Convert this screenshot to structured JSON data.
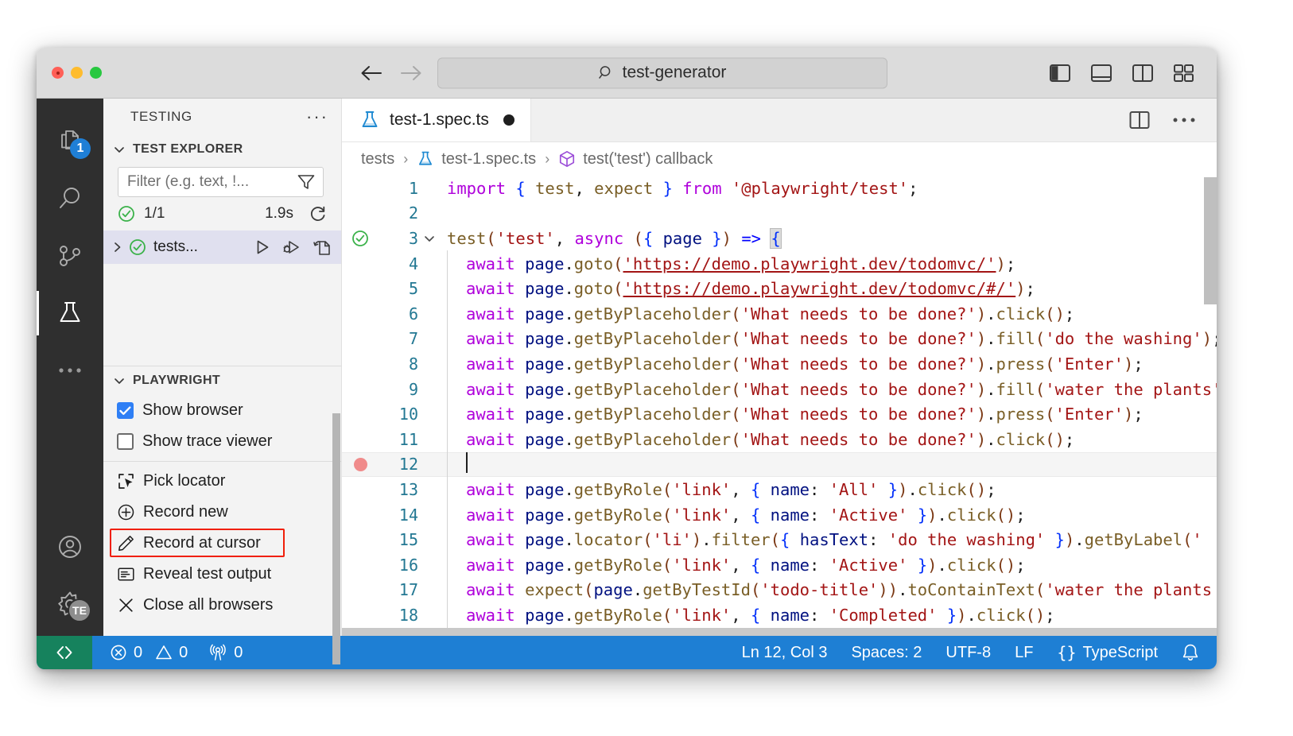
{
  "titlebar": {
    "command_center_text": "test-generator",
    "search_icon": "search-icon",
    "back_icon": "arrow-left-icon",
    "forward_icon": "arrow-right-icon",
    "layout_buttons": [
      {
        "name": "toggle-primary-sidebar",
        "icon": "panel-left-icon"
      },
      {
        "name": "toggle-panel",
        "icon": "panel-bottom-icon"
      },
      {
        "name": "toggle-secondary-sidebar",
        "icon": "panel-right-icon"
      },
      {
        "name": "customize-layout",
        "icon": "layout-grid-icon"
      }
    ]
  },
  "activitybar": {
    "items": [
      {
        "name": "explorer",
        "icon": "files-icon",
        "badge": "1",
        "active": false
      },
      {
        "name": "search",
        "icon": "search-icon",
        "badge": "",
        "active": false
      },
      {
        "name": "source-control",
        "icon": "source-control-icon",
        "badge": "",
        "active": false
      },
      {
        "name": "testing",
        "icon": "beaker-icon",
        "badge": "",
        "active": true
      },
      {
        "name": "more-views",
        "icon": "ellipsis-icon",
        "badge": "",
        "active": false
      }
    ],
    "bottom_items": [
      {
        "name": "accounts",
        "icon": "account-icon"
      },
      {
        "name": "manage",
        "icon": "gear-icon",
        "badge": "TE"
      }
    ]
  },
  "sidebar": {
    "title": "TESTING",
    "more_actions_icon": "ellipsis-icon",
    "test_explorer": {
      "header": "TEST EXPLORER",
      "chevron_icon": "chevron-down-icon",
      "filter_placeholder": "Filter (e.g. text, !...",
      "filter_value": "",
      "filter_icon": "filter-icon",
      "summary": {
        "status_icon": "check-circle-icon",
        "counts": "1/1",
        "duration": "1.9s",
        "refresh_icon": "refresh-icon"
      },
      "tree": [
        {
          "expand_icon": "chevron-right-icon",
          "status_icon": "check-circle-icon",
          "label": "tests...",
          "actions": [
            {
              "name": "run-test",
              "icon": "play-icon"
            },
            {
              "name": "debug-test",
              "icon": "debug-icon"
            },
            {
              "name": "continuous-run",
              "icon": "run-continuous-icon"
            }
          ]
        }
      ]
    },
    "playwright": {
      "header": "PLAYWRIGHT",
      "chevron_icon": "chevron-down-icon",
      "checkboxes": [
        {
          "label": "Show browser",
          "checked": true,
          "name": "show-browser"
        },
        {
          "label": "Show trace viewer",
          "checked": false,
          "name": "show-trace-viewer"
        }
      ],
      "actions": [
        {
          "label": "Pick locator",
          "icon": "pick-locator-icon",
          "name": "pick-locator",
          "highlighted": false
        },
        {
          "label": "Record new",
          "icon": "plus-circle-icon",
          "name": "record-new",
          "highlighted": false
        },
        {
          "label": "Record at cursor",
          "icon": "pencil-icon",
          "name": "record-at-cursor",
          "highlighted": true
        },
        {
          "label": "Reveal test output",
          "icon": "output-icon",
          "name": "reveal-test-output",
          "highlighted": false
        },
        {
          "label": "Close all browsers",
          "icon": "close-icon",
          "name": "close-all-browsers",
          "highlighted": false
        }
      ],
      "highlight_color": "#f01f09"
    }
  },
  "editor": {
    "tab": {
      "label": "test-1.spec.ts",
      "icon": "beaker-icon",
      "modified": true
    },
    "tab_actions": [
      {
        "name": "split-editor-right",
        "icon": "split-editor-icon"
      },
      {
        "name": "more-editor-actions",
        "icon": "ellipsis-icon"
      }
    ],
    "breadcrumbs": [
      {
        "label": "tests",
        "icon": ""
      },
      {
        "label": "test-1.spec.ts",
        "icon": "beaker-icon"
      },
      {
        "label": "test('test') callback",
        "icon": "symbol-object-icon"
      }
    ],
    "lines": [
      {
        "n": "1",
        "deco": "",
        "fold": "",
        "indent": 0,
        "text": "import { test, expect } from '@playwright/test';"
      },
      {
        "n": "2",
        "deco": "",
        "fold": "",
        "indent": 0,
        "text": ""
      },
      {
        "n": "3",
        "deco": "test-pass",
        "fold": "chevron-down-icon",
        "indent": 0,
        "text": "test('test', async ({ page }) => {"
      },
      {
        "n": "4",
        "deco": "",
        "fold": "",
        "indent": 1,
        "text": "await page.goto('https://demo.playwright.dev/todomvc/');"
      },
      {
        "n": "5",
        "deco": "",
        "fold": "",
        "indent": 1,
        "text": "await page.goto('https://demo.playwright.dev/todomvc/#/');"
      },
      {
        "n": "6",
        "deco": "",
        "fold": "",
        "indent": 1,
        "text": "await page.getByPlaceholder('What needs to be done?').click();"
      },
      {
        "n": "7",
        "deco": "",
        "fold": "",
        "indent": 1,
        "text": "await page.getByPlaceholder('What needs to be done?').fill('do the washing');"
      },
      {
        "n": "8",
        "deco": "",
        "fold": "",
        "indent": 1,
        "text": "await page.getByPlaceholder('What needs to be done?').press('Enter');"
      },
      {
        "n": "9",
        "deco": "",
        "fold": "",
        "indent": 1,
        "text": "await page.getByPlaceholder('What needs to be done?').fill('water the plants');"
      },
      {
        "n": "10",
        "deco": "",
        "fold": "",
        "indent": 1,
        "text": "await page.getByPlaceholder('What needs to be done?').press('Enter');"
      },
      {
        "n": "11",
        "deco": "",
        "fold": "",
        "indent": 1,
        "text": "await page.getByPlaceholder('What needs to be done?').click();"
      },
      {
        "n": "12",
        "deco": "breakpoint",
        "fold": "",
        "indent": 1,
        "text": "",
        "current": true
      },
      {
        "n": "13",
        "deco": "",
        "fold": "",
        "indent": 1,
        "text": "await page.getByRole('link', { name: 'All' }).click();"
      },
      {
        "n": "14",
        "deco": "",
        "fold": "",
        "indent": 1,
        "text": "await page.getByRole('link', { name: 'Active' }).click();"
      },
      {
        "n": "15",
        "deco": "",
        "fold": "",
        "indent": 1,
        "text": "await page.locator('li').filter({ hasText: 'do the washing' }).getByLabel('"
      },
      {
        "n": "16",
        "deco": "",
        "fold": "",
        "indent": 1,
        "text": "await page.getByRole('link', { name: 'Active' }).click();"
      },
      {
        "n": "17",
        "deco": "",
        "fold": "",
        "indent": 1,
        "text": "await expect(page.getByTestId('todo-title')).toContainText('water the plants"
      },
      {
        "n": "18",
        "deco": "",
        "fold": "",
        "indent": 1,
        "text": "await page.getByRole('link', { name: 'Completed' }).click();"
      }
    ]
  },
  "statusbar": {
    "remote_icon": "remote-indicator-icon",
    "left": [
      {
        "name": "errors",
        "icon": "error-icon",
        "value": "0"
      },
      {
        "name": "warnings",
        "icon": "warning-icon",
        "value": "0"
      },
      {
        "name": "ports",
        "icon": "radio-tower-icon",
        "value": "0"
      }
    ],
    "right": [
      {
        "name": "cursor-position",
        "label": "Ln 12, Col 3"
      },
      {
        "name": "indentation",
        "label": "Spaces: 2"
      },
      {
        "name": "encoding",
        "label": "UTF-8"
      },
      {
        "name": "eol",
        "label": "LF"
      },
      {
        "name": "language-mode",
        "label": "TypeScript",
        "icon": "braces-icon"
      },
      {
        "name": "notifications",
        "label": "",
        "icon": "bell-icon"
      }
    ]
  }
}
